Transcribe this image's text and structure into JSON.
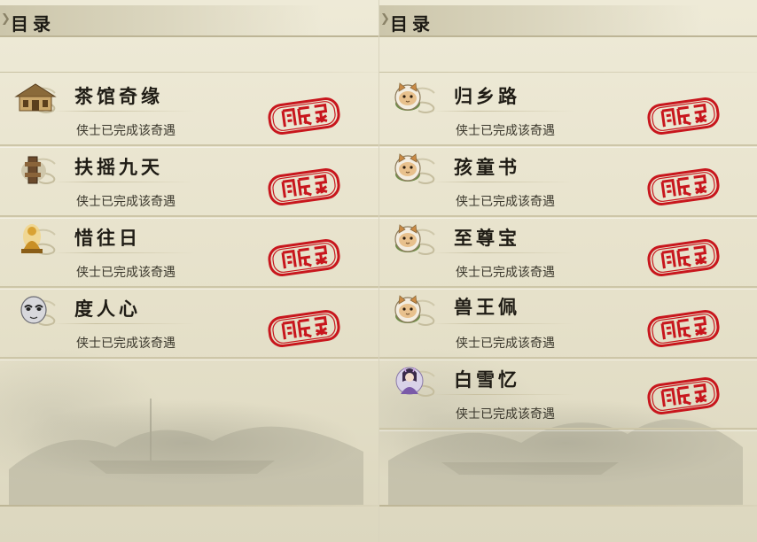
{
  "left_panel": {
    "title": "目录",
    "entries": [
      {
        "name": "茶馆奇缘",
        "status": "侠士已完成该奇遇",
        "icon": "teahouse-icon"
      },
      {
        "name": "扶摇九天",
        "status": "侠士已完成该奇遇",
        "icon": "drum-pillar-icon"
      },
      {
        "name": "惜往日",
        "status": "侠士已完成该奇遇",
        "icon": "golden-buddha-icon"
      },
      {
        "name": "度人心",
        "status": "侠士已完成该奇遇",
        "icon": "opera-mask-icon"
      }
    ]
  },
  "right_panel": {
    "title": "目录",
    "entries": [
      {
        "name": "归乡路",
        "status": "侠士已完成该奇遇",
        "icon": "cat-face-icon"
      },
      {
        "name": "孩童书",
        "status": "侠士已完成该奇遇",
        "icon": "cat-face-icon"
      },
      {
        "name": "至尊宝",
        "status": "侠士已完成该奇遇",
        "icon": "cat-face-icon"
      },
      {
        "name": "兽王佩",
        "status": "侠士已完成该奇遇",
        "icon": "cat-face-icon"
      },
      {
        "name": "白雪忆",
        "status": "侠士已完成该奇遇",
        "icon": "maiden-portrait-icon"
      }
    ]
  },
  "stamp_icon": "completed-seal-stamp-icon",
  "colors": {
    "parchment": "#e9e4cf",
    "stamp_red": "#c8161d",
    "title_text": "#1f1c15",
    "status_text": "#3a372c"
  }
}
